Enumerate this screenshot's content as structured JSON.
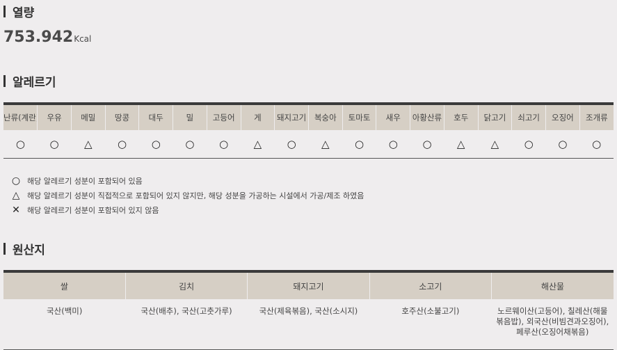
{
  "calorie": {
    "title": "열량",
    "value": "753.942",
    "unit": "Kcal"
  },
  "allergy": {
    "title": "알레르기",
    "headers": [
      "난류(계란)",
      "우유",
      "메밀",
      "땅콩",
      "대두",
      "밀",
      "고등어",
      "게",
      "돼지고기",
      "복숭아",
      "토마토",
      "새우",
      "아황산류",
      "호두",
      "닭고기",
      "쇠고기",
      "오징어",
      "조개류"
    ],
    "values": [
      "○",
      "○",
      "△",
      "○",
      "○",
      "○",
      "○",
      "△",
      "○",
      "△",
      "○",
      "○",
      "○",
      "△",
      "△",
      "○",
      "○",
      "○"
    ],
    "legend": [
      {
        "symbol": "○",
        "text": "해당 알레르기 성분이 포함되어 있음"
      },
      {
        "symbol": "△",
        "text": "해당 알레르기 성분이 직접적으로 포함되어 있지 않지만, 해당 성분을 가공하는 시설에서 가공/제조 하였음"
      },
      {
        "symbol": "✕",
        "text": "해당 알레르기 성분이 포함되어 있지 않음"
      }
    ]
  },
  "origin": {
    "title": "원산지",
    "headers": [
      "쌀",
      "김치",
      "돼지고기",
      "소고기",
      "해산물"
    ],
    "values": [
      "국산(백미)",
      "국산(배추), 국산(고춧가루)",
      "국산(제육볶음), 국산(소시지)",
      "호주산(소불고기)",
      "노르웨이산(고등어), 칠레산(해물볶음밥), 외국산(비빔견과오징어), 페루산(오징어채볶음)"
    ]
  }
}
